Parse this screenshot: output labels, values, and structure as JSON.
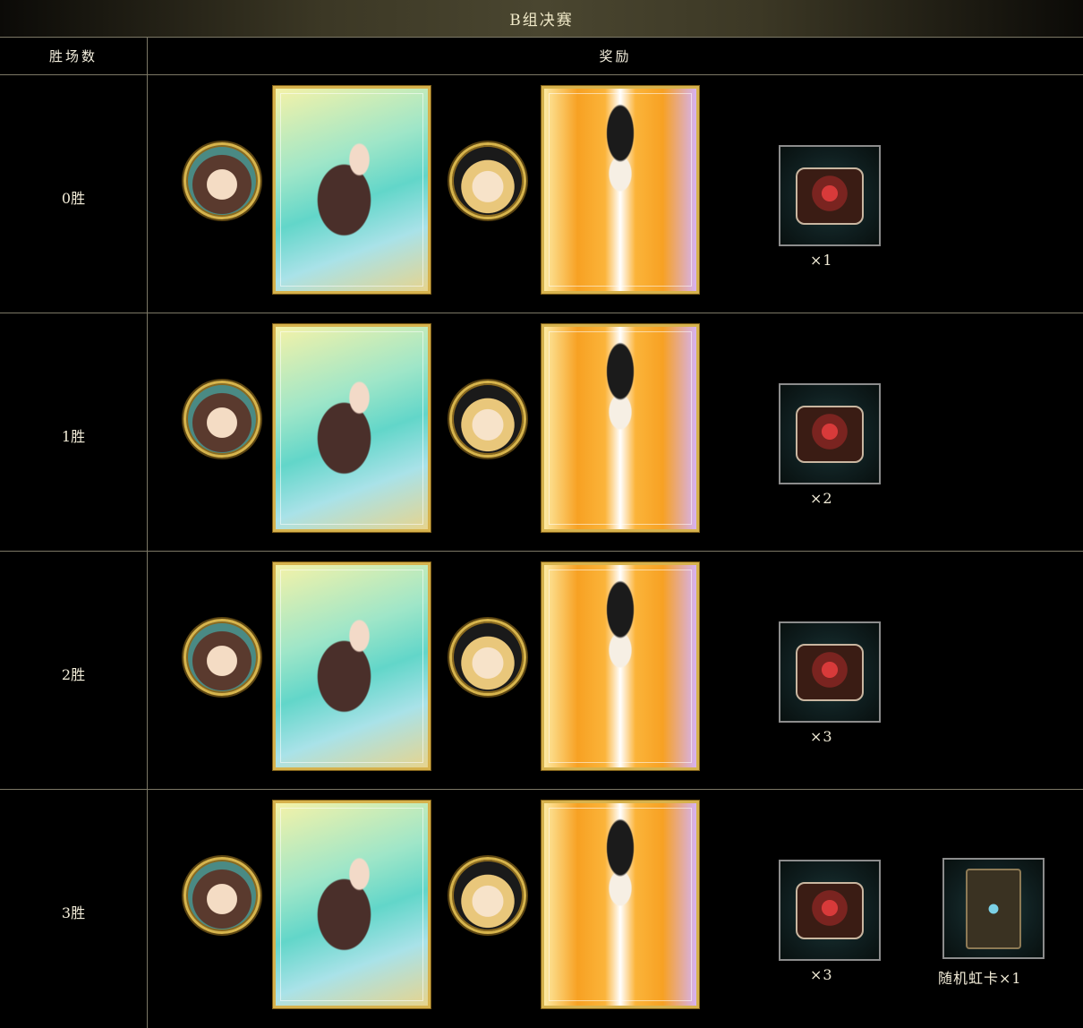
{
  "title": "B组决赛",
  "header": {
    "col_wins": "胜场数",
    "col_rewards": "奖励"
  },
  "rows": [
    {
      "wins": "0胜",
      "avatar1": "character-avatar-butterfly-girl",
      "card1": "butterfly-girl-card",
      "avatar2": "character-avatar-witch",
      "card2": "witch-card",
      "items": [
        {
          "icon": "crimson-knot-emblem-icon",
          "qty": "×1"
        }
      ]
    },
    {
      "wins": "1胜",
      "avatar1": "character-avatar-butterfly-girl",
      "card1": "butterfly-girl-card",
      "avatar2": "character-avatar-witch",
      "card2": "witch-card",
      "items": [
        {
          "icon": "crimson-knot-emblem-icon",
          "qty": "×2"
        }
      ]
    },
    {
      "wins": "2胜",
      "avatar1": "character-avatar-butterfly-girl",
      "card1": "butterfly-girl-card",
      "avatar2": "character-avatar-witch",
      "card2": "witch-card",
      "items": [
        {
          "icon": "crimson-knot-emblem-icon",
          "qty": "×3"
        }
      ]
    },
    {
      "wins": "3胜",
      "avatar1": "character-avatar-butterfly-girl",
      "card1": "butterfly-girl-card",
      "avatar2": "character-avatar-witch",
      "card2": "witch-card",
      "items": [
        {
          "icon": "crimson-knot-emblem-icon",
          "qty": "×3"
        },
        {
          "icon": "random-rainbow-card-deck-icon",
          "qty": "随机虹卡×1"
        }
      ]
    }
  ],
  "colors": {
    "border_gold": "#d6b24d",
    "grid_line": "#7c7866",
    "title_bg": "#4a4630"
  }
}
